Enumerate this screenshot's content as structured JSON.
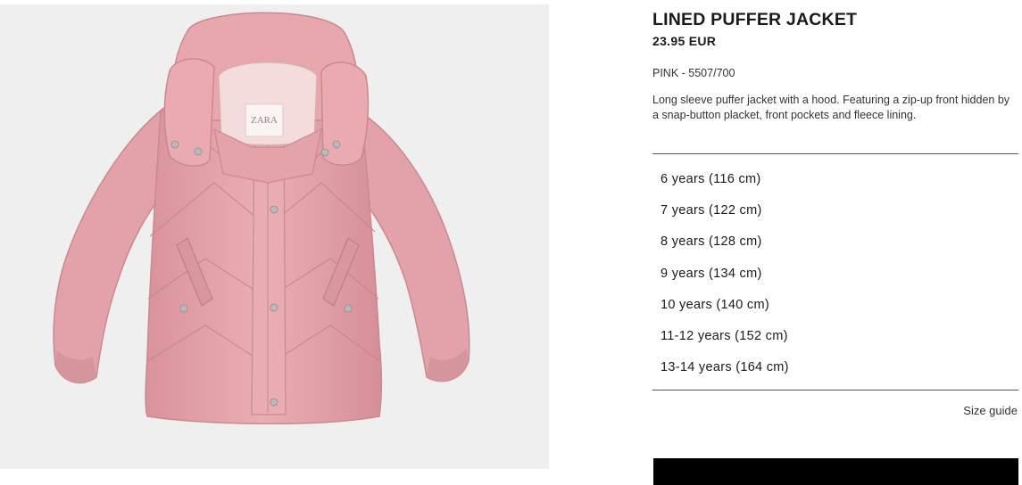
{
  "product": {
    "title": "LINED PUFFER JACKET",
    "price": "23.95 EUR",
    "color_ref": "PINK - 5507/700",
    "description": "Long sleeve puffer jacket with a hood. Featuring a zip-up front hidden by a snap-button placket, front pockets and fleece lining."
  },
  "sizes": [
    "6 years (116 cm)",
    "7 years (122 cm)",
    "8 years (128 cm)",
    "9 years (134 cm)",
    "10 years (140 cm)",
    "11-12 years (152 cm)",
    "13-14 years (164 cm)"
  ],
  "size_guide_label": "Size guide",
  "image": {
    "label_text": "ZARA",
    "colors": {
      "background": "#efefef",
      "jacket": "#e7a7ad",
      "jacket_shadow": "#cf8a92",
      "jacket_highlight": "#f2c3c7",
      "snap": "#b9b9bd",
      "fleece": "#f4dcdc"
    }
  }
}
